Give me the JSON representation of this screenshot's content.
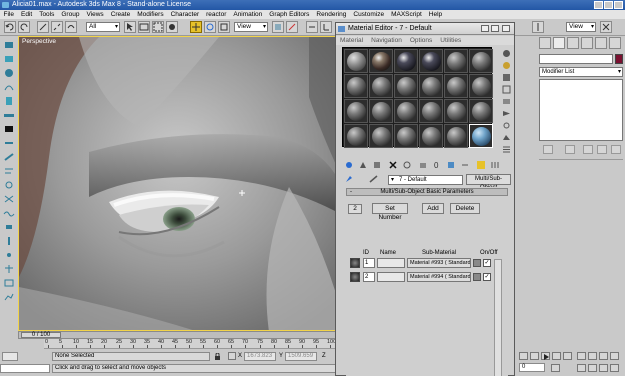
{
  "window": {
    "title": "Alicia01.max - Autodesk 3ds Max 8 - Stand-alone License"
  },
  "menubar": [
    "File",
    "Edit",
    "Tools",
    "Group",
    "Views",
    "Create",
    "Modifiers",
    "Character",
    "reactor",
    "Animation",
    "Graph Editors",
    "Rendering",
    "Customize",
    "MAXScript",
    "Help"
  ],
  "toolbar": {
    "selection_filter": "All",
    "ref_coord": "View"
  },
  "viewport": {
    "label": "Perspective"
  },
  "timeline": {
    "slider_label": "0 / 100",
    "ticks": [
      "0",
      "5",
      "10",
      "15",
      "20",
      "25",
      "30",
      "35",
      "40",
      "45",
      "50",
      "55",
      "60",
      "65",
      "70",
      "75",
      "80",
      "85",
      "90",
      "95",
      "100"
    ]
  },
  "status": {
    "selection": "None Selected",
    "prompt": "Click and drag to select and move objects",
    "x_label": "X",
    "x_value": "1673.823",
    "y_label": "Y",
    "y_value": "1509.659",
    "frame_value": "0"
  },
  "material_editor": {
    "title": "Material Editor - 7 - Default",
    "menu": [
      "Material",
      "Navigation",
      "Options",
      "Utilities"
    ],
    "material_name": "7 - Default",
    "material_type": "Multi/Sub-Object",
    "rollout_title": "Multi/Sub-Object Basic Parameters",
    "num_materials": "2",
    "set_number_label": "Set Number",
    "add_label": "Add",
    "delete_label": "Delete",
    "columns": {
      "id": "ID",
      "name": "Name",
      "submaterial": "Sub-Material",
      "onoff": "On/Off"
    },
    "rows": [
      {
        "id": "1",
        "name": "",
        "submaterial": "Material #993  ( Standard )",
        "on": "✓"
      },
      {
        "id": "2",
        "name": "",
        "submaterial": "Material #994  ( Standard )",
        "on": "✓"
      }
    ]
  },
  "command_panel": {
    "modifier_list": "Modifier List"
  }
}
